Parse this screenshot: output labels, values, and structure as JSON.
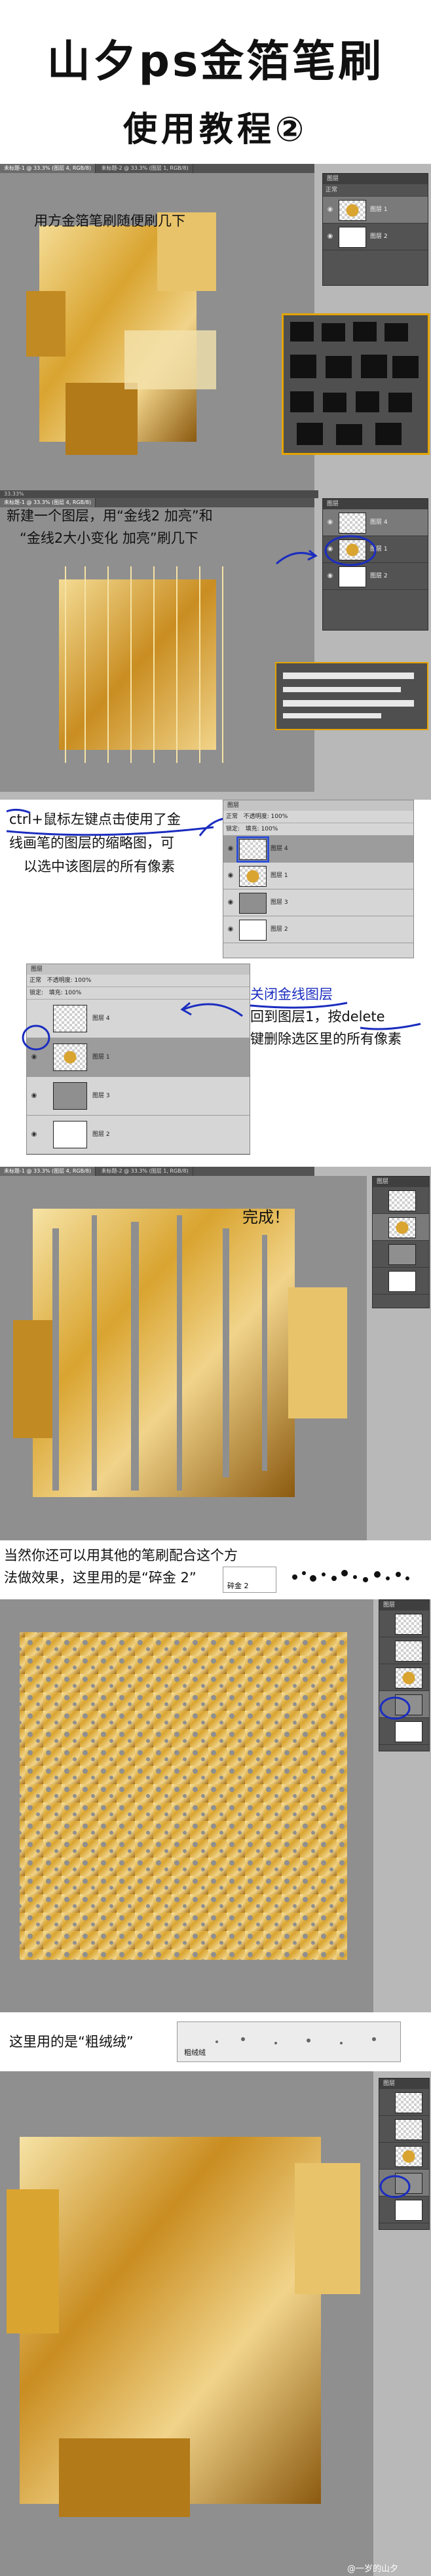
{
  "colors": {
    "workspace": "#b8b8b8",
    "canvas": "#8f8f8f",
    "gold_light": "#f1d48a",
    "gold_mid": "#d9a430",
    "gold_dark": "#8b5a10",
    "annotation_blue": "#1b2dbf",
    "brush_box_border": "#e4a400"
  },
  "header": {
    "title": "山夕ps金箔笔刷",
    "subtitle": "使用教程②"
  },
  "steps": [
    {
      "caption": "用方金箔笔刷随便刷几下"
    },
    {
      "caption_lines": [
        "新建一个图层，用“金线2 加亮”和",
        "“金线2大小变化 加亮”刷几下"
      ]
    },
    {
      "caption_lines": [
        "ctrl+鼠标左键点击使用了金",
        "线画笔的图层的缩略图，可",
        "以选中该图层的所有像素"
      ]
    },
    {
      "caption_lines": [
        "关闭金线图层",
        "回到图层1，按delete",
        "键删除选区里的所有像素"
      ]
    },
    {
      "caption": "完成！"
    },
    {
      "caption_lines": [
        "当然你还可以用其他的笔刷配合这个方",
        "法做效果，这里用的是“碎金 2”"
      ],
      "brush_name": "碎金 2"
    },
    {
      "caption": "这里用的是“粗绒绒”",
      "brush_name": "粗绒绒"
    }
  ],
  "layers_panel": {
    "title": "图层",
    "blend_mode": "正常",
    "opacity_label": "不透明度:",
    "opacity_value": "100%",
    "lock_label": "锁定:",
    "fill_label": "填充:",
    "fill_value": "100%",
    "layers": [
      "图层 4",
      "图层 1",
      "图层 3",
      "图层 2"
    ]
  },
  "document_tabs": [
    "未标题-1 @ 33.3% (图层 4, RGB/8)",
    "未标题-2 @ 33.3% (图层 1, RGB/8)"
  ],
  "status_text": "33.33%",
  "watermark": "@一岁的山夕"
}
